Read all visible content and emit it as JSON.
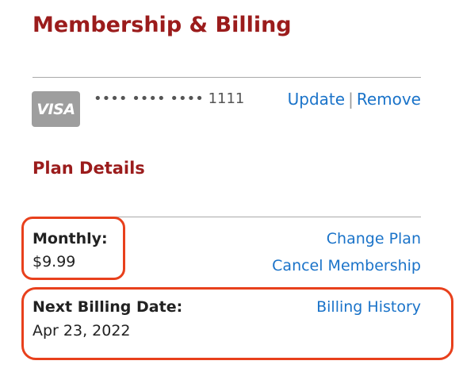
{
  "header": {
    "title": "Membership & Billing"
  },
  "payment": {
    "card_brand": "VISA",
    "card_number_masked": "•••• •••• •••• 1111",
    "update_label": "Update",
    "separator": "|",
    "remove_label": "Remove"
  },
  "plan_details": {
    "section_title": "Plan Details",
    "plan_label": "Monthly:",
    "plan_price": "$9.99",
    "change_plan_label": "Change Plan",
    "cancel_membership_label": "Cancel Membership",
    "next_billing_label": "Next Billing Date:",
    "next_billing_date": "Apr 23, 2022",
    "billing_history_label": "Billing History"
  },
  "colors": {
    "heading": "#9b1c1c",
    "link": "#1a73c9",
    "highlight": "#e8401c",
    "card_bg": "#9e9e9e"
  }
}
